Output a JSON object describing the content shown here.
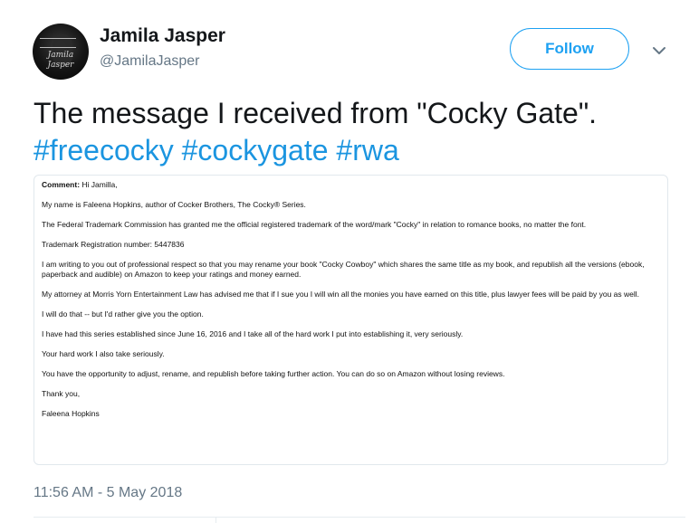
{
  "author": {
    "display_name": "Jamila Jasper",
    "handle": "@JamilaJasper",
    "avatar_icon": "avatar-photo"
  },
  "actions": {
    "follow_label": "Follow",
    "menu_icon": "chevron-down-icon"
  },
  "tweet": {
    "text": "The message I received from \"Cocky Gate\".",
    "hashtags": [
      "#freecocky",
      "#cockygate",
      "#rwa"
    ]
  },
  "media": {
    "comment_label": "Comment:",
    "greeting": "Hi Jamilla,",
    "paragraphs": [
      "My name is Faleena Hopkins, author of Cocker Brothers, The Cocky® Series.",
      "The Federal Trademark Commission has granted me the official registered trademark of the word/mark \"Cocky\" in relation to romance books, no matter the font.",
      "Trademark Registration number: 5447836",
      "I am writing to you out of professional respect so that you may rename your book \"Cocky Cowboy\" which shares the same title as my book, and republish all the versions (ebook, paperback and audible) on Amazon to keep your ratings and money earned.",
      "My attorney at Morris Yorn Entertainment Law has advised me that if I sue you I will win all the monies you have earned on this title, plus lawyer fees will be paid by you as well.",
      "I will do that -- but I'd rather give you the option.",
      "I have had this series established since June 16, 2016 and I take all of the hard work I put into establishing it, very seriously.",
      "Your hard work I also take seriously.",
      "You have the opportunity to adjust, rename, and republish before taking further action. You can do so on Amazon without losing reviews.",
      "Thank you,",
      "Faleena Hopkins"
    ]
  },
  "timestamp": "11:56 AM - 5 May 2018",
  "colors": {
    "accent": "#1da1f2",
    "hashtag": "#1b95e0",
    "secondary_text": "#657786",
    "border": "#e1e8ed"
  }
}
